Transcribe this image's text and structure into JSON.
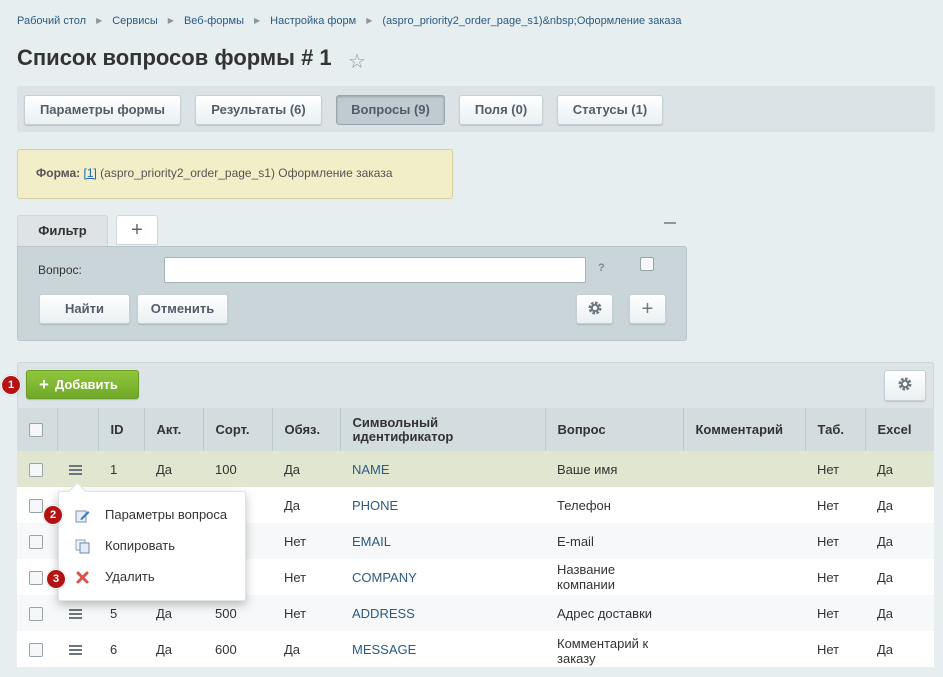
{
  "breadcrumb": [
    "Рабочий стол",
    "Сервисы",
    "Веб-формы",
    "Настройка форм",
    "(aspro_priority2_order_page_s1)&nbsp;Оформление заказа"
  ],
  "page": {
    "title": "Список вопросов формы # 1"
  },
  "tabs": [
    {
      "label": "Параметры формы",
      "active": false
    },
    {
      "label": "Результаты (6)",
      "active": false
    },
    {
      "label": "Вопросы (9)",
      "active": true
    },
    {
      "label": "Поля (0)",
      "active": false
    },
    {
      "label": "Статусы (1)",
      "active": false
    }
  ],
  "form_info": {
    "label": "Форма:",
    "id_link": "[1]",
    "text": "(aspro_priority2_order_page_s1) Оформление заказа"
  },
  "filter": {
    "tab_label": "Фильтр",
    "add_tab_symbol": "+",
    "field_label": "Вопрос:",
    "field_value": "",
    "help": "?",
    "find_label": "Найти",
    "cancel_label": "Отменить",
    "plus_symbol": "+"
  },
  "toolbar": {
    "add_label": "Добавить",
    "add_symbol": "+"
  },
  "badges": [
    "1",
    "2",
    "3"
  ],
  "table": {
    "columns": [
      "ID",
      "Акт.",
      "Сорт.",
      "Обяз.",
      "Символьный идентификатор",
      "Вопрос",
      "Комментарий",
      "Таб.",
      "Excel"
    ],
    "rows": [
      {
        "id": "1",
        "active": "Да",
        "sort": "100",
        "required": "Да",
        "code": "NAME",
        "question": "Ваше имя",
        "comment": "",
        "tab": "Нет",
        "excel": "Да"
      },
      {
        "id": "",
        "active": "",
        "sort": "",
        "required": "Да",
        "code": "PHONE",
        "question": "Телефон",
        "comment": "",
        "tab": "Нет",
        "excel": "Да"
      },
      {
        "id": "",
        "active": "",
        "sort": "",
        "required": "Нет",
        "code": "EMAIL",
        "question": "E-mail",
        "comment": "",
        "tab": "Нет",
        "excel": "Да"
      },
      {
        "id": "",
        "active": "",
        "sort": "",
        "required": "Нет",
        "code": "COMPANY",
        "question": "Название компании",
        "comment": "",
        "tab": "Нет",
        "excel": "Да"
      },
      {
        "id": "5",
        "active": "Да",
        "sort": "500",
        "required": "Нет",
        "code": "ADDRESS",
        "question": "Адрес доставки",
        "comment": "",
        "tab": "Нет",
        "excel": "Да"
      },
      {
        "id": "6",
        "active": "Да",
        "sort": "600",
        "required": "Да",
        "code": "MESSAGE",
        "question": "Комментарий к заказу",
        "comment": "",
        "tab": "Нет",
        "excel": "Да"
      }
    ]
  },
  "context_menu": {
    "items": [
      {
        "label": "Параметры вопроса",
        "icon": "edit-icon"
      },
      {
        "label": "Копировать",
        "icon": "copy-icon"
      },
      {
        "label": "Удалить",
        "icon": "delete-icon"
      }
    ]
  },
  "colors": {
    "accent_green": "#7cb632",
    "badge_red": "#b51313",
    "link_blue": "#2c5a80"
  }
}
